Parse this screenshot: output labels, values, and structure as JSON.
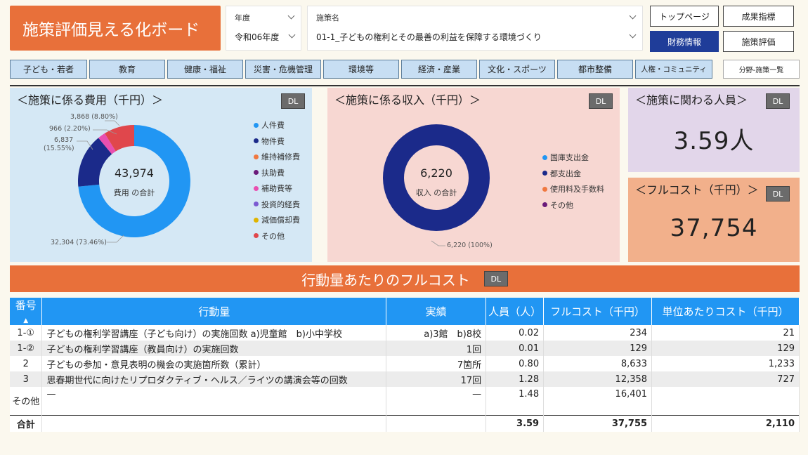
{
  "header": {
    "title": "施策評価見える化ボード",
    "year_label": "年度",
    "year_value": "令和06年度",
    "policy_label": "施策名",
    "policy_value": "01-1_子どもの権利とその最善の利益を保障する環境づくり",
    "buttons": {
      "top_page": "トップページ",
      "outcome": "成果指標",
      "finance": "財務情報",
      "evaluation": "施策評価"
    }
  },
  "categories": [
    "子ども・若者",
    "教育",
    "健康・福祉",
    "災害・危機管理",
    "環境等",
    "経済・産業",
    "文化・スポーツ",
    "都市整備",
    "人権・コミュニティ",
    "分野-施策一覧"
  ],
  "dl_label": "DL",
  "cost_panel": {
    "title": "＜施策に係る費用（千円）＞",
    "total": "43,974",
    "total_label": "費用 の合計",
    "labels": {
      "personnel": "32,304 (73.46%)",
      "goods": "6,837",
      "goods_pct": "(15.55%)",
      "subsidy": "966 (2.20%)",
      "other": "3,868 (8.80%)"
    },
    "legend": [
      {
        "name": "人件費",
        "color": "#2196f3"
      },
      {
        "name": "物件費",
        "color": "#1b2a8a"
      },
      {
        "name": "維持補修費",
        "color": "#f07840"
      },
      {
        "name": "扶助費",
        "color": "#6a1b7a"
      },
      {
        "name": "補助費等",
        "color": "#e94fb0"
      },
      {
        "name": "投資的経費",
        "color": "#7b5ad1"
      },
      {
        "name": "減価償却費",
        "color": "#e0b400"
      },
      {
        "name": "その他",
        "color": "#e0474c"
      }
    ]
  },
  "revenue_panel": {
    "title": "＜施策に係る収入（千円）＞",
    "total": "6,220",
    "total_label": "収入 の合計",
    "slice_label": "6,220 (100%)",
    "legend": [
      {
        "name": "国庫支出金",
        "color": "#2196f3"
      },
      {
        "name": "都支出金",
        "color": "#1b2a8a"
      },
      {
        "name": "使用料及手数料",
        "color": "#f07840"
      },
      {
        "name": "その他",
        "color": "#6a1b7a"
      }
    ]
  },
  "people_panel": {
    "title": "＜施策に関わる人員＞",
    "value": "3.59人"
  },
  "fullcost_panel": {
    "title": "＜フルコスト（千円）＞",
    "value": "37,754"
  },
  "action_section": {
    "title": "行動量あたりのフルコスト",
    "columns": [
      "番号",
      "行動量",
      "実績",
      "人員（人）",
      "フルコスト（千円）",
      "単位あたりコスト（千円）"
    ],
    "rows": [
      [
        "1-①",
        "子どもの権利学習講座（子ども向け）の実施回数 a)児童館　b)小中学校",
        "a)3館　b)8校",
        "0.02",
        "234",
        "21"
      ],
      [
        "1-②",
        "子どもの権利学習講座（教員向け）の実施回数",
        "1回",
        "0.01",
        "129",
        "129"
      ],
      [
        "2",
        "子どもの参加・意見表明の機会の実施箇所数（累計）",
        "7箇所",
        "0.80",
        "8,633",
        "1,233"
      ],
      [
        "3",
        "思春期世代に向けたリプロダクティブ・ヘルス／ライツの講演会等の回数",
        "17回",
        "1.28",
        "12,358",
        "727"
      ],
      [
        "その他",
        "—",
        "—",
        "1.48",
        "16,401",
        ""
      ]
    ],
    "total_row": [
      "合計",
      "",
      "",
      "3.59",
      "37,755",
      "2,110"
    ]
  }
}
